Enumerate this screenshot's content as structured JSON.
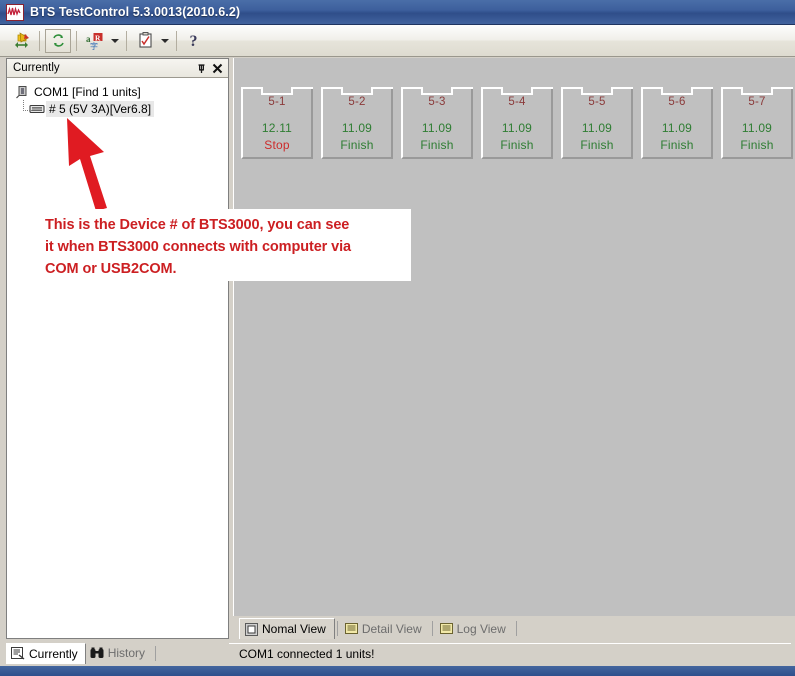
{
  "window": {
    "title": "BTS TestControl 5.3.0013(2010.6.2)",
    "icon": "waveform-icon"
  },
  "toolbar": {
    "buttons": [
      {
        "name": "connect-device-button",
        "icon": "plug-arrow-icon",
        "has_dropdown": false,
        "framed": false
      },
      {
        "name": "refresh-button",
        "icon": "refresh-icon",
        "has_dropdown": false,
        "framed": true
      },
      {
        "name": "language-button",
        "icon": "language-icon",
        "has_dropdown": true,
        "framed": false
      },
      {
        "name": "schedule-button",
        "icon": "clipboard-check-icon",
        "has_dropdown": true,
        "framed": false
      },
      {
        "name": "help-button",
        "icon": "question-help-icon",
        "has_dropdown": false,
        "framed": false
      }
    ]
  },
  "left_panel": {
    "caption": "Currently",
    "pin_icon": "pushpin-icon",
    "close_icon": "close-icon",
    "tree": {
      "root": {
        "label": "COM1 [Find 1 units]",
        "icon": "com-port-icon"
      },
      "child": {
        "label": "# 5 (5V  3A)[Ver6.8]",
        "icon": "device-module-icon",
        "selected": true
      }
    }
  },
  "channels": [
    {
      "id": "5-1",
      "value": "12.11",
      "state": "Stop",
      "value_color": "#2e7d32",
      "state_color": "#cc2b2b"
    },
    {
      "id": "5-2",
      "value": "11.09",
      "state": "Finish",
      "value_color": "#2e7d32",
      "state_color": "#2e7d32"
    },
    {
      "id": "5-3",
      "value": "11.09",
      "state": "Finish",
      "value_color": "#2e7d32",
      "state_color": "#2e7d32"
    },
    {
      "id": "5-4",
      "value": "11.09",
      "state": "Finish",
      "value_color": "#2e7d32",
      "state_color": "#2e7d32"
    },
    {
      "id": "5-5",
      "value": "11.09",
      "state": "Finish",
      "value_color": "#2e7d32",
      "state_color": "#2e7d32"
    },
    {
      "id": "5-6",
      "value": "11.09",
      "state": "Finish",
      "value_color": "#2e7d32",
      "state_color": "#2e7d32"
    },
    {
      "id": "5-7",
      "value": "11.09",
      "state": "Finish",
      "value_color": "#2e7d32",
      "state_color": "#2e7d32"
    }
  ],
  "view_tabs": [
    {
      "label": "Nomal View",
      "icon": "normal-view-icon",
      "active": true
    },
    {
      "label": "Detail View",
      "icon": "detail-view-icon",
      "active": false
    },
    {
      "label": "Log View",
      "icon": "log-view-icon",
      "active": false
    }
  ],
  "bottom_tabs": [
    {
      "label": "Currently",
      "icon": "currently-icon",
      "active": true
    },
    {
      "label": "History",
      "icon": "binoculars-icon",
      "active": false
    }
  ],
  "status_bar": {
    "message": "COM1 connected 1 units!"
  },
  "annotation": {
    "line1": "This is the Device # of BTS3000, you can see",
    "line2": "it when BTS3000 connects with computer via",
    "line3": "COM or USB2COM.",
    "color": "#cc1f22",
    "arrow_icon": "red-arrow-pointer"
  },
  "colors": {
    "titlebar": "#3d5f9c",
    "client_background": "#c0c0c0",
    "chrome": "#d4d0c8",
    "accent_red": "#cc1f22",
    "state_finish": "#2e7d32",
    "state_stop": "#cc2b2b",
    "channel_id": "#8b3a3a"
  }
}
